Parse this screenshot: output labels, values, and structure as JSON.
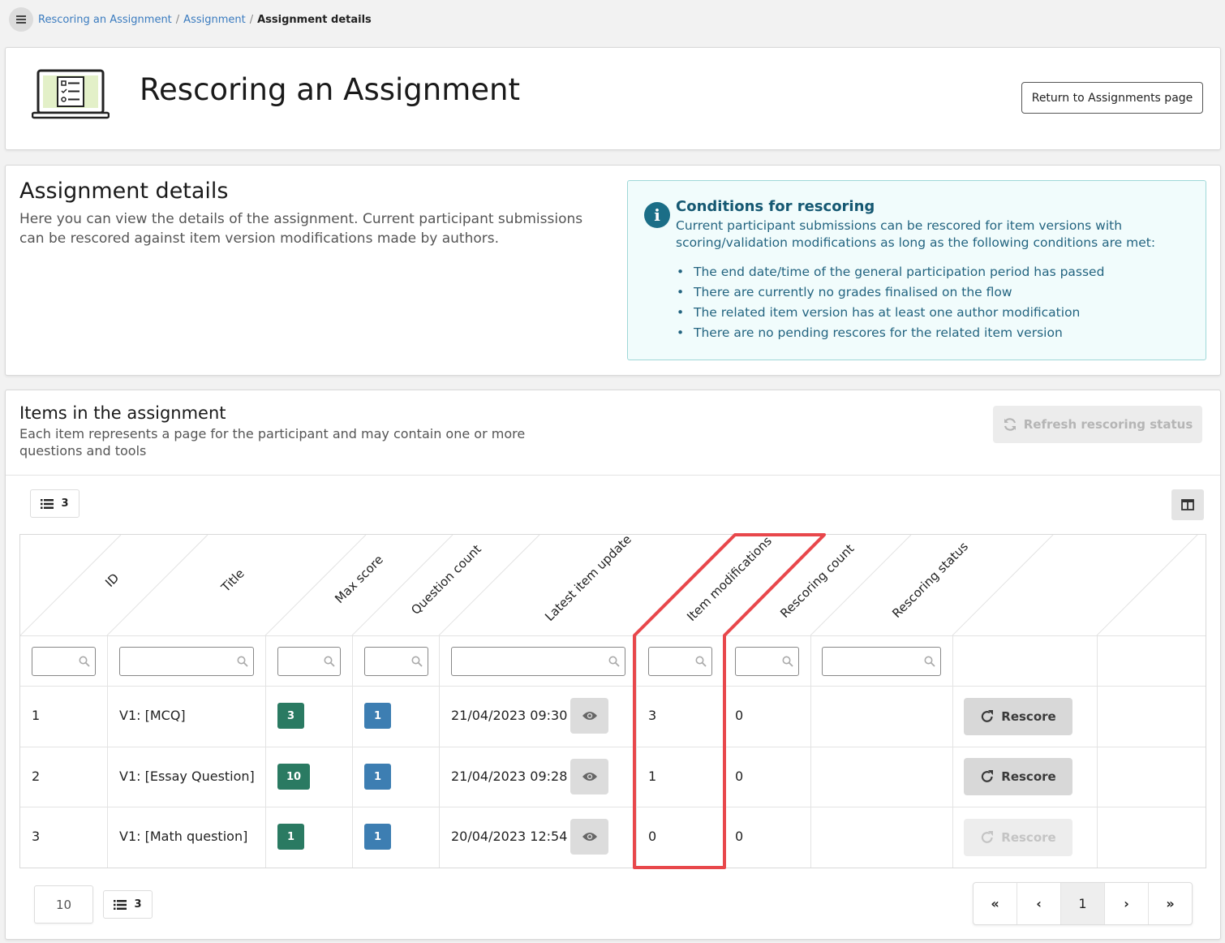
{
  "breadcrumb": {
    "items": [
      "Rescoring an Assignment",
      "Assignment"
    ],
    "current": "Assignment details",
    "separator": "/"
  },
  "header": {
    "title": "Rescoring an Assignment",
    "return_button": "Return to Assignments page"
  },
  "details": {
    "title": "Assignment details",
    "description": "Here you can view the details of the assignment. Current participant submissions can be rescored against item version modifications made by authors.",
    "conditions": {
      "title": "Conditions for rescoring",
      "intro": "Current participant submissions can be rescored for item versions with scoring/validation modifications as long as the following conditions are met:",
      "items": [
        "The end date/time of the general participation period has passed",
        "There are currently no grades finalised on the flow",
        "The related item version has at least one author modification",
        "There are no pending rescores for the related item version"
      ]
    }
  },
  "items_section": {
    "title": "Items in the assignment",
    "description": "Each item represents a page for the participant and may contain one or more questions and tools",
    "refresh_button": "Refresh rescoring status",
    "row_count": "3",
    "columns": [
      "ID",
      "Title",
      "Max score",
      "Question count",
      "Latest item update",
      "Item modifications",
      "Rescoring count",
      "Rescoring status"
    ],
    "rows": [
      {
        "id": "1",
        "title": "V1: [MCQ]",
        "max_score": "3",
        "question_count": "1",
        "latest_update": "21/04/2023 09:30",
        "item_modifications": "3",
        "rescoring_count": "0",
        "rescore_label": "Rescore",
        "rescore_enabled": true
      },
      {
        "id": "2",
        "title": "V1: [Essay Question]",
        "max_score": "10",
        "question_count": "1",
        "latest_update": "21/04/2023 09:28",
        "item_modifications": "1",
        "rescoring_count": "0",
        "rescore_label": "Rescore",
        "rescore_enabled": true
      },
      {
        "id": "3",
        "title": "V1: [Math question]",
        "max_score": "1",
        "question_count": "1",
        "latest_update": "20/04/2023 12:54",
        "item_modifications": "0",
        "rescoring_count": "0",
        "rescore_label": "Rescore",
        "rescore_enabled": false
      }
    ],
    "page_size": "10",
    "footer_count": "3",
    "pagination": {
      "first": "«",
      "prev": "‹",
      "current": "1",
      "next": "›",
      "last": "»"
    }
  },
  "colors": {
    "link": "#3a7bbf",
    "max_score_badge": "#2a7a62",
    "question_badge": "#3d7eb2",
    "info_text": "#1e5c78",
    "annotation": "#e8474b"
  },
  "icons": [
    "menu-icon",
    "laptop-checklist-icon",
    "info-icon",
    "refresh-icon",
    "list-icon",
    "columns-icon",
    "search-icon",
    "eye-icon",
    "redo-icon"
  ]
}
